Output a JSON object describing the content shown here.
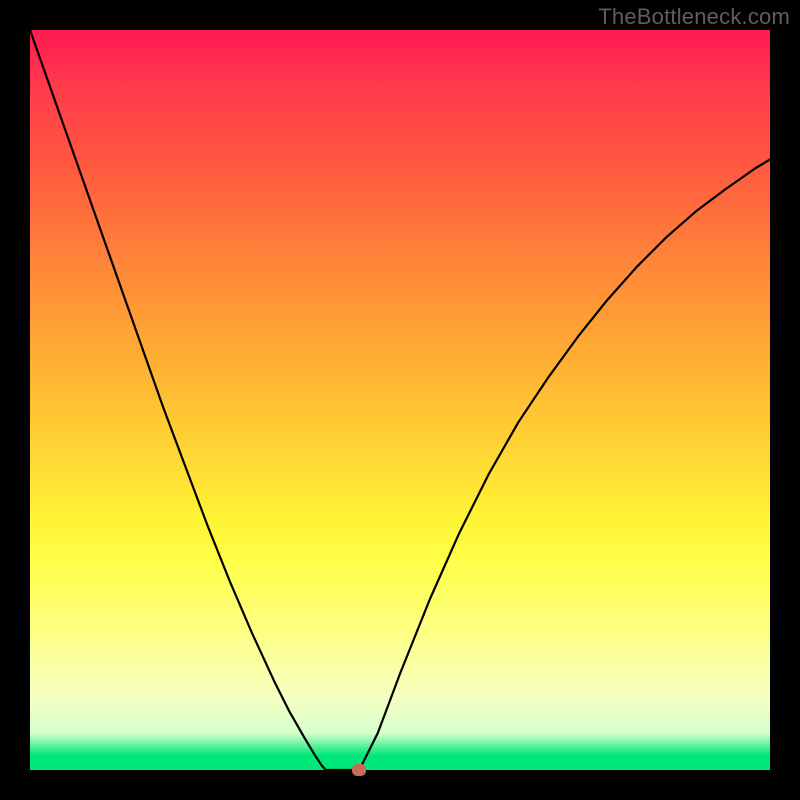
{
  "watermark": "TheBottleneck.com",
  "chart_data": {
    "type": "line",
    "title": "",
    "xlabel": "",
    "ylabel": "",
    "xlim": [
      0,
      1
    ],
    "ylim": [
      0,
      1
    ],
    "series": [
      {
        "name": "left-branch",
        "x": [
          0.0,
          0.03,
          0.06,
          0.09,
          0.12,
          0.15,
          0.18,
          0.21,
          0.24,
          0.27,
          0.3,
          0.33,
          0.35,
          0.37,
          0.385,
          0.395,
          0.4
        ],
        "y": [
          1.0,
          0.915,
          0.83,
          0.745,
          0.66,
          0.575,
          0.49,
          0.41,
          0.33,
          0.255,
          0.185,
          0.12,
          0.08,
          0.045,
          0.02,
          0.005,
          0.0
        ]
      },
      {
        "name": "valley-floor",
        "x": [
          0.4,
          0.445
        ],
        "y": [
          0.0,
          0.0
        ]
      },
      {
        "name": "right-branch",
        "x": [
          0.445,
          0.47,
          0.5,
          0.54,
          0.58,
          0.62,
          0.66,
          0.7,
          0.74,
          0.78,
          0.82,
          0.86,
          0.9,
          0.94,
          0.98,
          1.0
        ],
        "y": [
          0.0,
          0.05,
          0.13,
          0.23,
          0.32,
          0.4,
          0.47,
          0.53,
          0.585,
          0.635,
          0.68,
          0.72,
          0.755,
          0.785,
          0.813,
          0.825
        ]
      }
    ],
    "marker": {
      "x": 0.445,
      "y": 0.0
    },
    "background_gradient": {
      "top": "#ff1a52",
      "mid": "#fff334",
      "bottom": "#00e87a"
    }
  }
}
